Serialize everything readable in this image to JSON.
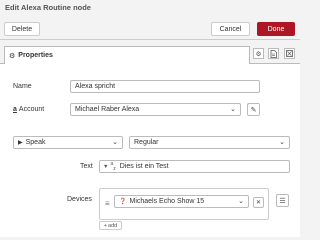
{
  "header": {
    "title": "Edit Alexa Routine node",
    "delete_label": "Delete",
    "cancel_label": "Cancel",
    "done_label": "Done"
  },
  "tabs": {
    "properties_label": "Properties",
    "properties_icon": "gear-icon",
    "side_icons": [
      "gear-icon",
      "document-icon",
      "expand-icon"
    ]
  },
  "form": {
    "name_label": "Name",
    "name_value": "Alexa spricht",
    "account_label": "Account",
    "account_icon": "amazon-a-icon",
    "account_value": "Michael Raber Alexa",
    "action_value": "Speak",
    "action_icon": "play-icon",
    "mode_value": "Regular",
    "text_label": "Text",
    "text_type_icon": "string-type-icon",
    "text_value": "Dies ist ein Test",
    "devices_label": "Devices",
    "device_value": "Michaels Echo Show 15",
    "device_icon": "question-circle-icon",
    "add_label": "add"
  },
  "colors": {
    "done_button": "#ad1625",
    "background": "#f3f3f3"
  }
}
